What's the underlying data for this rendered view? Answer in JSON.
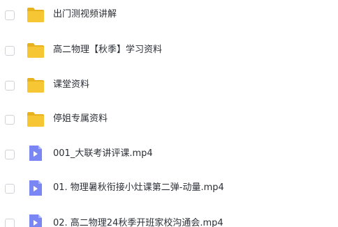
{
  "files": [
    {
      "type": "folder",
      "name": "出门测视频讲解"
    },
    {
      "type": "folder",
      "name": "高二物理【秋季】学习资料"
    },
    {
      "type": "folder",
      "name": "课堂资料"
    },
    {
      "type": "folder",
      "name": "停姐专属资料"
    },
    {
      "type": "video",
      "name": "001_大联考讲评课.mp4"
    },
    {
      "type": "video",
      "name": "01. 物理暑秋衔接小灶课第二弹-动量.mp4"
    },
    {
      "type": "video",
      "name": "02. 高二物理24秋季开班家校沟通会.mp4"
    }
  ],
  "colors": {
    "folder": "#f7c634",
    "folder_tab": "#e8b21f",
    "video": "#7b86f5",
    "video_fold": "#aeb6fb"
  }
}
